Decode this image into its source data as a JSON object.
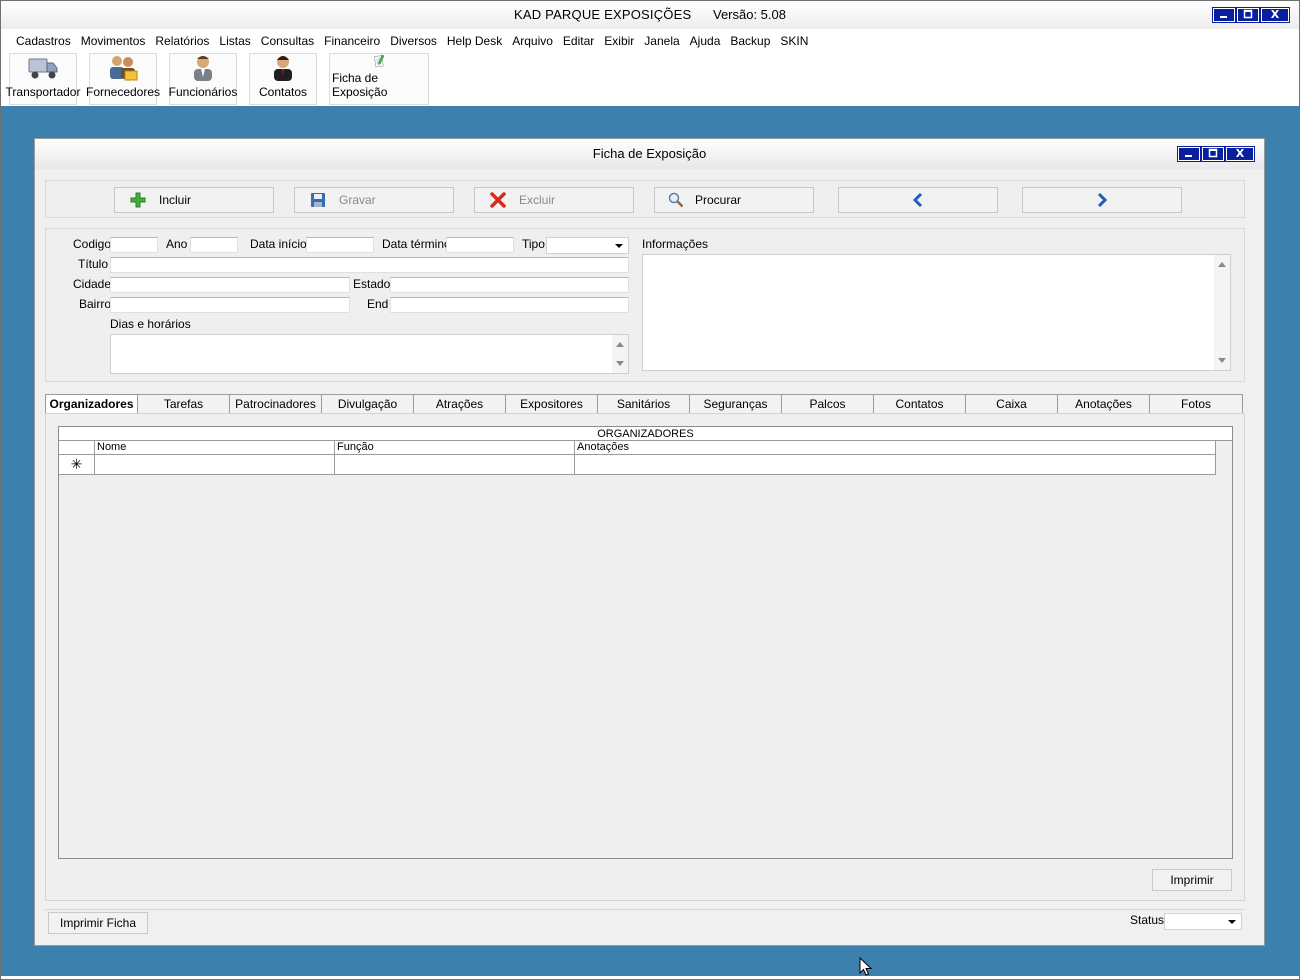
{
  "app": {
    "title": "KAD PARQUE EXPOSIÇÕES",
    "version": "Versão: 5.08",
    "controls": {
      "minimize": "_",
      "maximize": "▭",
      "close": "X"
    }
  },
  "menu": [
    "Cadastros",
    "Movimentos",
    "Relatórios",
    "Listas",
    "Consultas",
    "Financeiro",
    "Diversos",
    "Help Desk",
    "Arquivo",
    "Editar",
    "Exibir",
    "Janela",
    "Ajuda",
    "Backup",
    "SKIN"
  ],
  "toolbar": [
    {
      "label": "Transportador",
      "icon": "truck-icon"
    },
    {
      "label": "Fornecedores",
      "icon": "suppliers-icon"
    },
    {
      "label": "Funcionários",
      "icon": "employee-icon"
    },
    {
      "label": "Contatos",
      "icon": "contact-icon"
    },
    {
      "label": "Ficha de Exposição",
      "icon": "exhibition-sheet-icon"
    }
  ],
  "window": {
    "title": "Ficha de Exposição",
    "actions": {
      "incluir": "Incluir",
      "gravar": "Gravar",
      "excluir": "Excluir",
      "procurar": "Procurar"
    },
    "form": {
      "codigo": "Codigo",
      "ano": "Ano",
      "data_inicio": "Data início",
      "data_termino": "Data término",
      "tipo": "Tipo",
      "titulo": "Título",
      "cidade": "Cidade",
      "estado": "Estado",
      "bairro": "Bairro",
      "end": "End",
      "dias_horarios": "Dias e horários",
      "informacoes": "Informações"
    },
    "tabs": [
      "Organizadores",
      "Tarefas",
      "Patrocinadores",
      "Divulgação",
      "Atrações",
      "Expositores",
      "Sanitários",
      "Seguranças",
      "Palcos",
      "Contatos",
      "Caixa",
      "Anotações",
      "Fotos"
    ],
    "active_tab": "Organizadores",
    "grid": {
      "title": "ORGANIZADORES",
      "columns": [
        "Nome",
        "Função",
        "Anotações"
      ],
      "new_row_marker": "✳"
    },
    "imprimir": "Imprimir",
    "imprimir_ficha": "Imprimir Ficha",
    "status_label": "Status"
  }
}
